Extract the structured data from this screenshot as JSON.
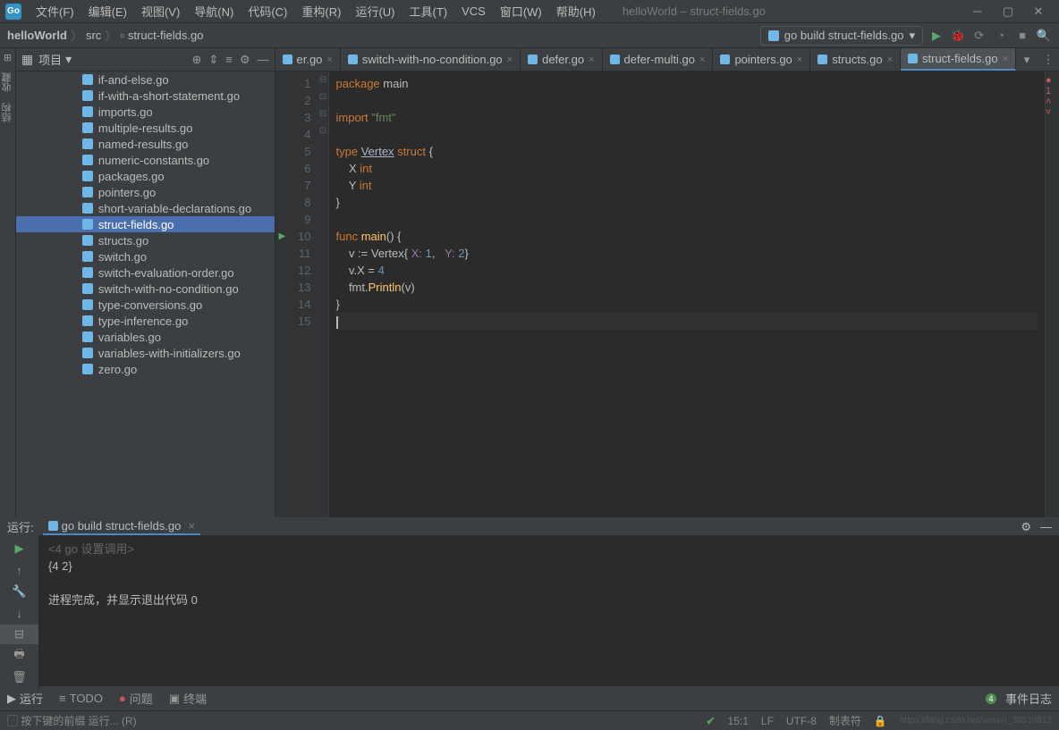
{
  "window_title": "helloWorld – struct-fields.go",
  "menu": [
    "文件(F)",
    "编辑(E)",
    "视图(V)",
    "导航(N)",
    "代码(C)",
    "重构(R)",
    "运行(U)",
    "工具(T)",
    "VCS",
    "窗口(W)",
    "帮助(H)"
  ],
  "breadcrumb": {
    "project": "helloWorld",
    "dir": "src",
    "file": "struct-fields.go"
  },
  "run_config": "go build struct-fields.go",
  "project_panel_title": "项目",
  "files": [
    "if-and-else.go",
    "if-with-a-short-statement.go",
    "imports.go",
    "multiple-results.go",
    "named-results.go",
    "numeric-constants.go",
    "packages.go",
    "pointers.go",
    "short-variable-declarations.go",
    "struct-fields.go",
    "structs.go",
    "switch.go",
    "switch-evaluation-order.go",
    "switch-with-no-condition.go",
    "type-conversions.go",
    "type-inference.go",
    "variables.go",
    "variables-with-initializers.go",
    "zero.go"
  ],
  "selected_file": "struct-fields.go",
  "tabs": [
    "er.go",
    "switch-with-no-condition.go",
    "defer.go",
    "defer-multi.go",
    "pointers.go",
    "structs.go",
    "struct-fields.go"
  ],
  "active_tab": "struct-fields.go",
  "error_count": "1",
  "code_lines": 15,
  "code": {
    "l1": {
      "kw": "package",
      "id": "main"
    },
    "l3": {
      "kw": "import",
      "str": "\"fmt\""
    },
    "l5": {
      "kw1": "type",
      "ty": "Vertex",
      "kw2": "struct",
      "op": "{"
    },
    "l6": {
      "id": "X",
      "ty": "int"
    },
    "l7": {
      "id": "Y",
      "ty": "int"
    },
    "l8": {
      "op": "}"
    },
    "l10": {
      "kw": "func",
      "fn": "main",
      "op": "() {"
    },
    "l11": {
      "pre": "v := ",
      "ty": "Vertex",
      "b1": "{ ",
      "f1": "X:",
      "n1": "1",
      "c": ",   ",
      "f2": "Y:",
      "n2": "2",
      "b2": "}"
    },
    "l12": {
      "txt": "v.X = ",
      "n": "4"
    },
    "l13": {
      "pre": "fmt.",
      "fn": "Println",
      "args": "(v)"
    },
    "l14": {
      "op": "}"
    }
  },
  "run_panel_label": "运行:",
  "run_tab": "go build struct-fields.go",
  "run_hint": "<4 go 设置调用>",
  "run_output": "{4 2}",
  "run_exit": "进程完成，并显示退出代码 0",
  "bottom_tabs": {
    "run": "运行",
    "todo": "TODO",
    "problems": "问题",
    "terminal": "终端"
  },
  "event_log": "事件日志",
  "event_count": "4",
  "status_hint": "按下键的前缀 运行... (R)",
  "status_right": {
    "pos": "15:1",
    "enc": "LF",
    "sp": "UTF-8",
    "ind": "制表符",
    "lock": "🔒"
  },
  "watermark": "https://blog.csdn.net/weixin_38510812"
}
